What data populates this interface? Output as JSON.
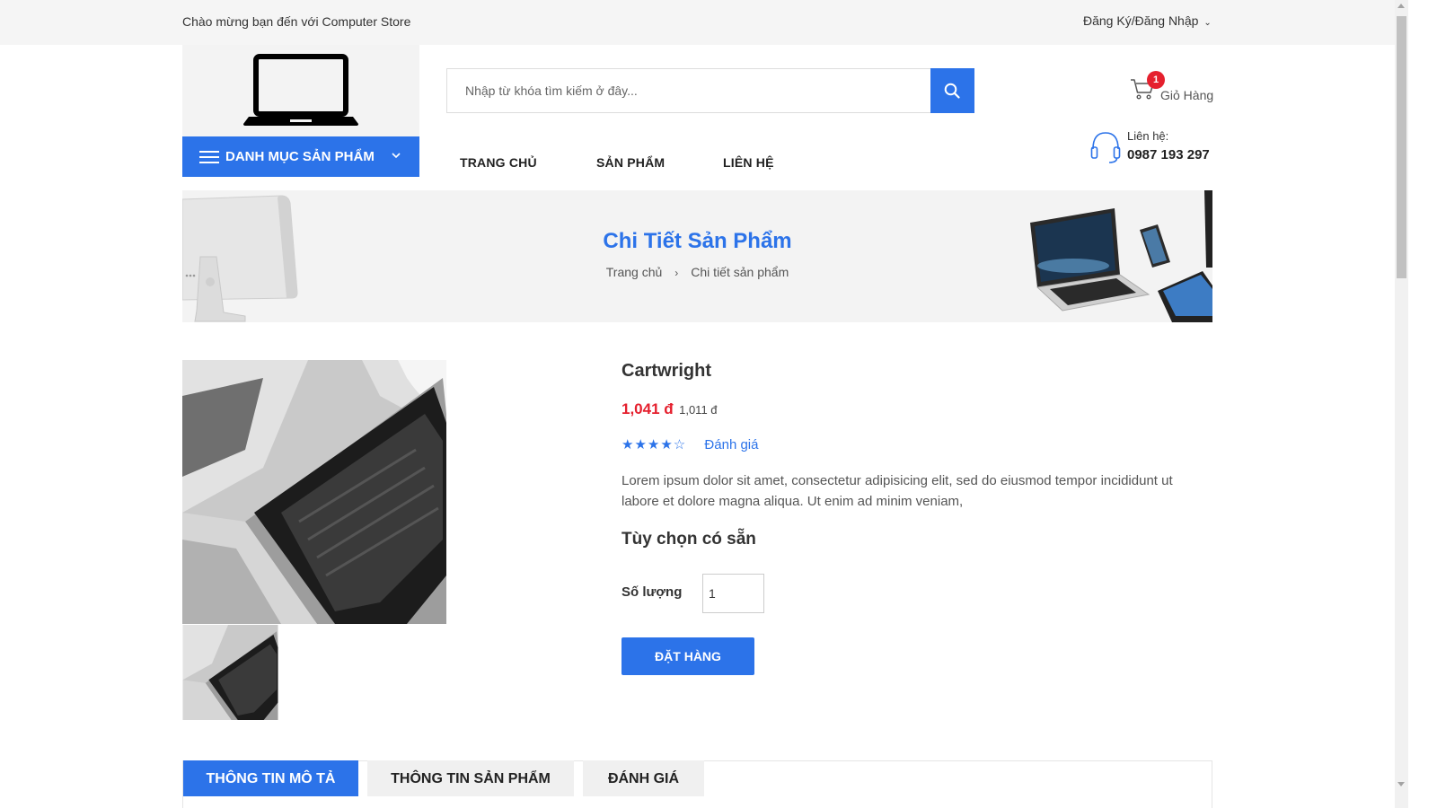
{
  "topbar": {
    "welcome": "Chào mừng bạn đến với Computer Store",
    "account": "Đăng Ký/Đăng Nhập"
  },
  "header": {
    "logo_icon": "laptop-icon",
    "category_button": "DANH MỤC SẢN PHẨM",
    "search_placeholder": "Nhập từ khóa tìm kiếm ở đây...",
    "cart": {
      "label": "Giỏ Hàng",
      "count": "1"
    },
    "contact": {
      "label": "Liên hệ:",
      "phone": "0987 193 297"
    },
    "nav": [
      "TRANG CHỦ",
      "SẢN PHẨM",
      "LIÊN HỆ"
    ]
  },
  "banner": {
    "title": "Chi Tiết Sản Phẩm",
    "breadcrumb": [
      "Trang chủ",
      "Chi tiết sản phẩm"
    ]
  },
  "product": {
    "name": "Cartwright",
    "price": "1,041 đ",
    "old_price": "1,011 đ",
    "stars": "★★★★☆",
    "rating_value": 4,
    "rating_max": 5,
    "rating_link": "Đánh giá",
    "description": "Lorem ipsum dolor sit amet, consectetur adipisicing elit, sed do eiusmod tempor incididunt ut labore et dolore magna aliqua. Ut enim ad minim veniam,",
    "options_heading": "Tùy chọn có sẵn",
    "quantity_label": "Số lượng",
    "quantity_value": "1",
    "order_button": "ĐẶT HÀNG"
  },
  "tabs": [
    "THÔNG TIN MÔ TẢ",
    "THÔNG TIN SẢN PHẨM",
    "ĐÁNH GIÁ"
  ],
  "colors": {
    "accent": "#2c73e9",
    "price": "#e5202e",
    "badge": "#e5202e"
  }
}
